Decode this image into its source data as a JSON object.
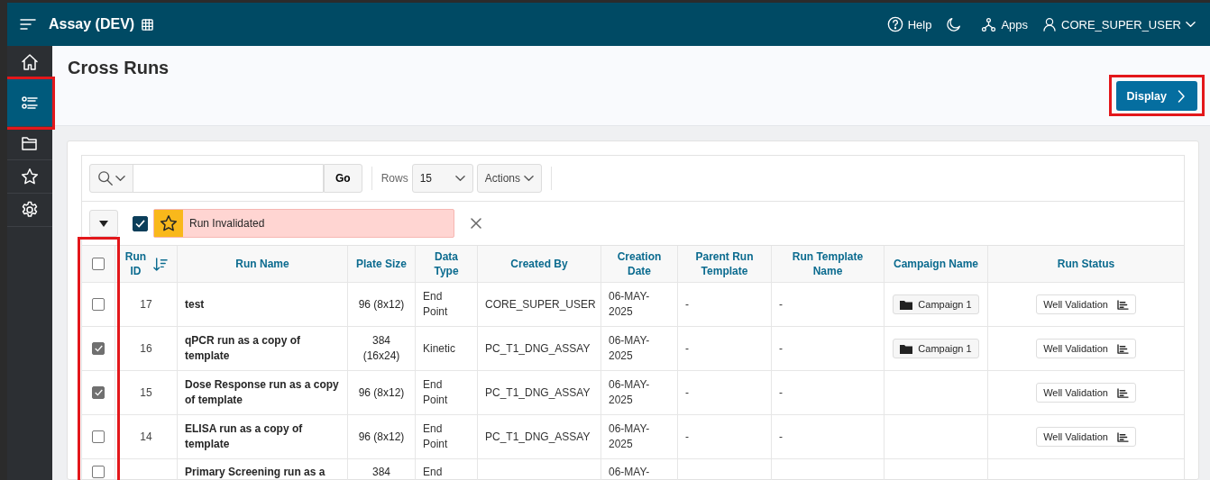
{
  "header": {
    "app_title": "Assay (DEV)",
    "help": "Help",
    "apps": "Apps",
    "user": "CORE_SUPER_USER"
  },
  "sidebar": {
    "items": [
      {
        "kind": "home",
        "selected": false,
        "highlighted": false
      },
      {
        "kind": "list",
        "selected": true,
        "highlighted": true
      },
      {
        "kind": "folder",
        "selected": false,
        "highlighted": false
      },
      {
        "kind": "star",
        "selected": false,
        "highlighted": false
      },
      {
        "kind": "gear",
        "selected": false,
        "highlighted": false
      }
    ]
  },
  "page_title": "Cross Runs",
  "display_button": {
    "label": "Display",
    "highlighted": true
  },
  "toolbar": {
    "go": "Go",
    "rows_label": "Rows",
    "rows_value": "15",
    "actions": "Actions"
  },
  "filter": {
    "checked": true,
    "label": "Run Invalidated"
  },
  "table": {
    "select_all_checked": false,
    "select_column_highlighted": true,
    "columns": [
      {
        "label": "Run ID",
        "kind": "number",
        "sorted": true
      },
      {
        "label": "Run Name",
        "kind": "bold",
        "sorted": false
      },
      {
        "label": "Plate Size",
        "kind": "center",
        "sorted": false
      },
      {
        "label": "Data Type",
        "kind": "text",
        "sorted": false
      },
      {
        "label": "Created By",
        "kind": "text",
        "sorted": false
      },
      {
        "label": "Creation Date",
        "kind": "text",
        "sorted": false
      },
      {
        "label": "Parent Run Template",
        "kind": "text",
        "sorted": false
      },
      {
        "label": "Run Template Name",
        "kind": "text",
        "sorted": false
      },
      {
        "label": "Campaign Name",
        "kind": "campaign",
        "sorted": false
      },
      {
        "label": "Run Status",
        "kind": "status",
        "sorted": false
      }
    ],
    "rows": [
      {
        "checked": false,
        "cells": [
          "17",
          "test",
          "96 (8x12)",
          "End Point",
          "CORE_SUPER_USER",
          "06-MAY-2025",
          "-",
          "-",
          "Campaign 1",
          "Well Validation"
        ]
      },
      {
        "checked": true,
        "cells": [
          "16",
          "qPCR run as a copy of template",
          "384 (16x24)",
          "Kinetic",
          "PC_T1_DNG_ASSAY",
          "06-MAY-2025",
          "-",
          "-",
          "Campaign 1",
          "Well Validation"
        ]
      },
      {
        "checked": true,
        "cells": [
          "15",
          "Dose Response run as a copy of template",
          "96 (8x12)",
          "End Point",
          "PC_T1_DNG_ASSAY",
          "06-MAY-2025",
          "-",
          "-",
          null,
          "Well Validation"
        ]
      },
      {
        "checked": false,
        "cells": [
          "14",
          "ELISA run as a copy of template",
          "96 (8x12)",
          "End Point",
          "PC_T1_DNG_ASSAY",
          "06-MAY-2025",
          "-",
          "-",
          null,
          "Well Validation"
        ]
      },
      {
        "checked": false,
        "cells": [
          null,
          "Primary Screening run as a",
          "384",
          "End",
          null,
          "06-MAY-",
          null,
          null,
          null,
          null
        ]
      }
    ]
  }
}
